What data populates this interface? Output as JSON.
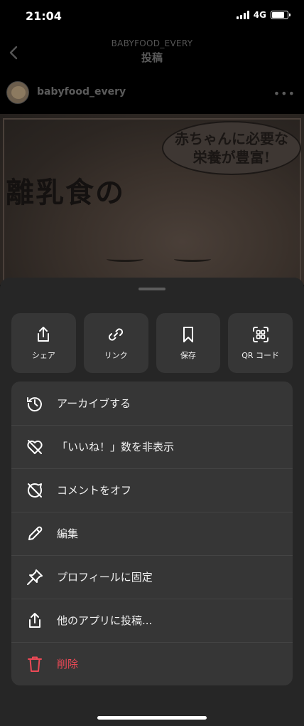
{
  "status": {
    "time": "21:04",
    "network": "4G"
  },
  "header": {
    "account": "BABYFOOD_EVERY",
    "title": "投稿"
  },
  "post": {
    "username": "babyfood_every",
    "image_text": {
      "bubble_line1": "赤ちゃんに必要な",
      "bubble_line2": "栄養が豊富!",
      "title": "離乳食の"
    }
  },
  "quick_actions": [
    {
      "label": "シェア",
      "icon": "share-icon"
    },
    {
      "label": "リンク",
      "icon": "link-icon"
    },
    {
      "label": "保存",
      "icon": "bookmark-icon"
    },
    {
      "label": "QR コード",
      "icon": "qr-code-icon"
    }
  ],
  "menu": [
    {
      "label": "アーカイブする",
      "icon": "archive-history-icon"
    },
    {
      "label": "「いいね！」数を非表示",
      "icon": "heart-off-icon"
    },
    {
      "label": "コメントをオフ",
      "icon": "comment-off-icon"
    },
    {
      "label": "編集",
      "icon": "pencil-icon"
    },
    {
      "label": "プロフィールに固定",
      "icon": "pin-icon"
    },
    {
      "label": "他のアプリに投稿...",
      "icon": "share-icon"
    },
    {
      "label": "削除",
      "icon": "trash-icon"
    }
  ],
  "colors": {
    "sheet": "#262626",
    "button": "#363636",
    "danger": "#ed4956"
  }
}
